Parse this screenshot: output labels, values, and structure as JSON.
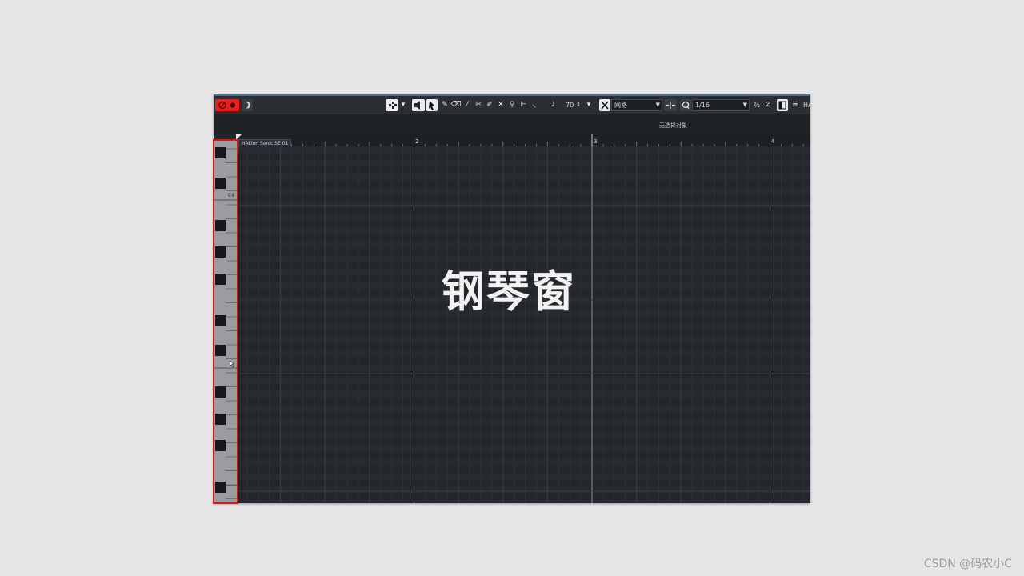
{
  "overlay": {
    "title": "钢琴窗",
    "credit": "CSDN @码农小C",
    "highlight_color": "#d21818"
  },
  "toolbar": {
    "record_icon": "record-enable-icon",
    "velocity_value": "70",
    "snap_type": "网格",
    "quantize_value": "1/16",
    "cut_label": "HA"
  },
  "status": {
    "selection_text": "无选择对象"
  },
  "ruler": {
    "bars": [
      "2",
      "3",
      "4"
    ]
  },
  "part": {
    "name": "HALion Sonic SE 01"
  },
  "keyboard": {
    "c4_label": "C4"
  },
  "colors": {
    "background": "#e6e6e6",
    "editor_bg": "#22262b",
    "record_red": "#e8201f",
    "accent_blue": "#4a6f8e"
  }
}
